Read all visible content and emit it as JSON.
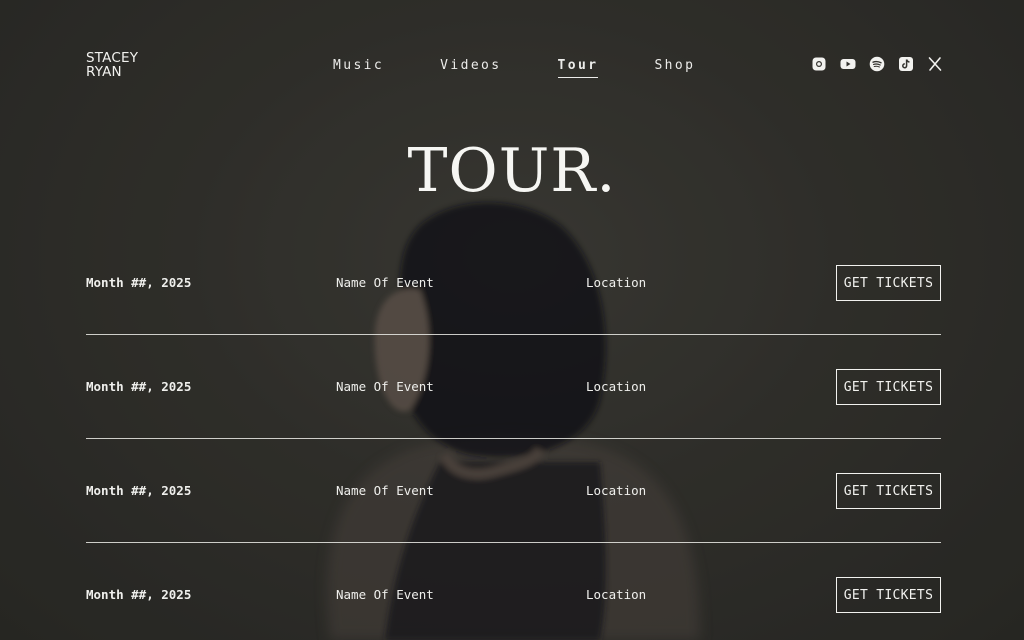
{
  "brand": {
    "line1": "STACEY",
    "line2": "RYAN"
  },
  "nav": {
    "items": [
      {
        "label": "Music"
      },
      {
        "label": "Videos"
      },
      {
        "label": "Tour",
        "active": true
      },
      {
        "label": "Shop"
      }
    ]
  },
  "social": {
    "icons": [
      "instagram-icon",
      "youtube-icon",
      "spotify-icon",
      "tiktok-icon",
      "x-icon"
    ]
  },
  "page": {
    "title": "TOUR."
  },
  "events": [
    {
      "date": "Month ##, 2025",
      "name": "Name Of Event",
      "location": "Location",
      "button": "GET TICKETS"
    },
    {
      "date": "Month ##, 2025",
      "name": "Name Of Event",
      "location": "Location",
      "button": "GET TICKETS"
    },
    {
      "date": "Month ##, 2025",
      "name": "Name Of Event",
      "location": "Location",
      "button": "GET TICKETS"
    },
    {
      "date": "Month ##, 2025",
      "name": "Name Of Event",
      "location": "Location",
      "button": "GET TICKETS"
    }
  ],
  "colors": {
    "background": "#34332f",
    "text": "#f2f2ef"
  }
}
